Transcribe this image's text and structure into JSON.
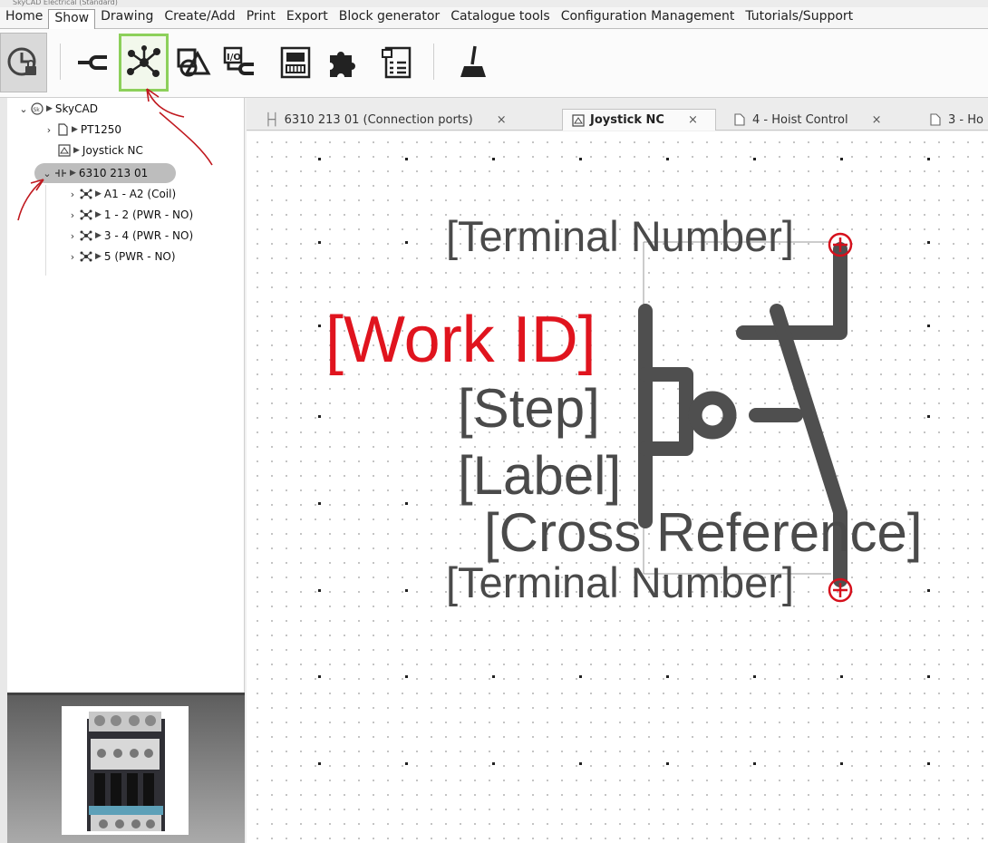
{
  "app": {
    "title": "SkyCAD Electrical (Standard)"
  },
  "menu": {
    "items": [
      "Home",
      "Show",
      "Drawing",
      "Create/Add",
      "Print",
      "Export",
      "Block generator",
      "Catalogue tools",
      "Configuration Management",
      "Tutorials/Support"
    ],
    "active": "Show"
  },
  "ribbon": {
    "buttons": [
      "clock-lock-icon",
      "connector-icon",
      "network-nodes-icon",
      "shapes-icon",
      "io-icon",
      "terminal-block-icon",
      "puzzle-icon",
      "list-icon",
      "broom-icon"
    ],
    "selected": "network-nodes-icon",
    "selected_color": "#8cd05a"
  },
  "tree": {
    "root": "SkyCAD",
    "items": [
      {
        "label": "PT1250"
      },
      {
        "label": "Joystick NC"
      },
      {
        "label": "6310 213 01",
        "selected": true
      },
      {
        "label": "A1 - A2 (Coil)"
      },
      {
        "label": "1 - 2 (PWR - NO)"
      },
      {
        "label": "3 - 4 (PWR - NO)"
      },
      {
        "label": "5 (PWR - NO)"
      }
    ]
  },
  "tabs": [
    {
      "label": "6310 213 01 (Connection ports)",
      "close": "×"
    },
    {
      "label": "Joystick NC",
      "close": "×",
      "active": true
    },
    {
      "label": "4 - Hoist Control",
      "close": "×"
    },
    {
      "label": "3 - Ho"
    }
  ],
  "symbol": {
    "terminal_top": "[Terminal Number]",
    "work_id": "[Work ID]",
    "step": "[Step]",
    "label": "[Label]",
    "cross_reference": "[Cross Reference]",
    "terminal_bottom": "[Terminal Number]",
    "work_id_color": "#e0141e",
    "text_color": "#4a4a4a",
    "port_color": "#d6101c"
  },
  "annotation_color": "#c0181e"
}
